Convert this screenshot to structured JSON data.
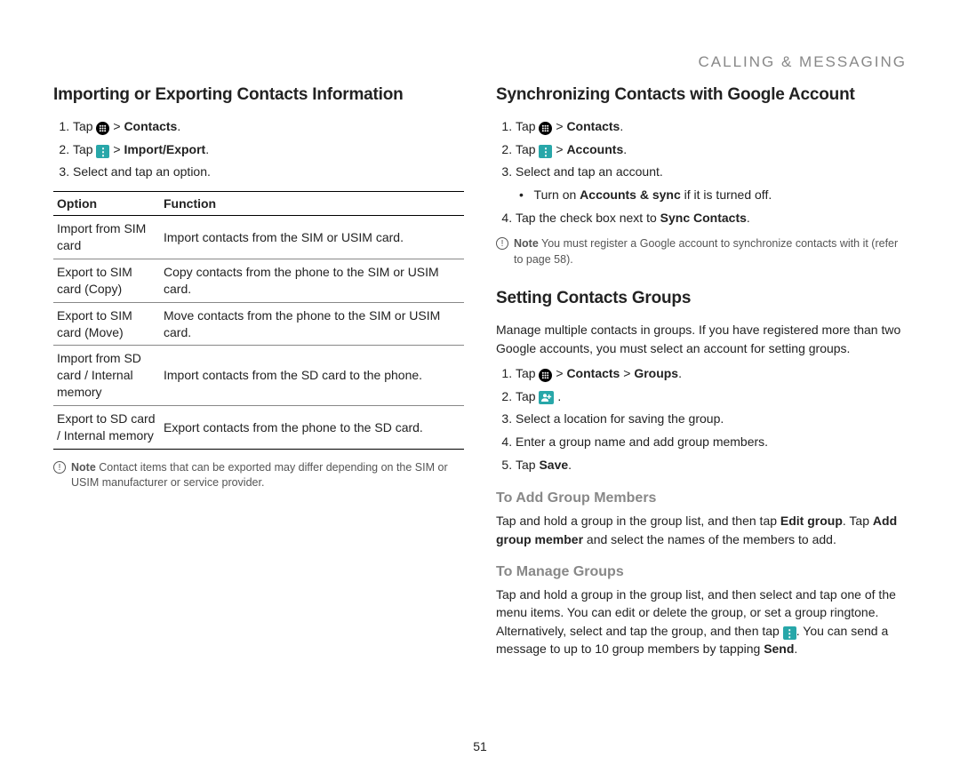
{
  "header": "CALLING & MESSAGING",
  "page_number": "51",
  "left": {
    "heading": "Importing or Exporting Contacts Information",
    "steps": {
      "s1_prefix": "Tap ",
      "s1_suffix": " > ",
      "s1_bold": "Contacts",
      "s1_end": ".",
      "s2_prefix": "Tap ",
      "s2_suffix": " > ",
      "s2_bold": "Import/Export",
      "s2_end": ".",
      "s3": "Select and tap an option."
    },
    "table": {
      "h1": "Option",
      "h2": "Function",
      "rows": [
        {
          "opt": "Import from SIM card",
          "fn": "Import contacts from the SIM or USIM card."
        },
        {
          "opt": "Export to SIM card (Copy)",
          "fn": "Copy contacts from the phone to the SIM or USIM card."
        },
        {
          "opt": "Export to SIM card (Move)",
          "fn": "Move contacts from the phone to the SIM or USIM card."
        },
        {
          "opt": "Import from SD card / Internal memory",
          "fn": "Import contacts from the SD card to the phone."
        },
        {
          "opt": "Export to SD card / Internal memory",
          "fn": "Export contacts from the phone to the SD card."
        }
      ]
    },
    "note": {
      "label": "Note",
      "text": " Contact items that can be exported may differ depending on the SIM or USIM manufacturer or service provider."
    }
  },
  "right": {
    "sync": {
      "heading": "Synchronizing Contacts with Google Account",
      "s1_prefix": "Tap ",
      "s1_suffix": " > ",
      "s1_bold": "Contacts",
      "s1_end": ".",
      "s2_prefix": "Tap ",
      "s2_suffix": " > ",
      "s2_bold": "Accounts",
      "s2_end": ".",
      "s3": "Select and tap an account.",
      "s3_sub_prefix": "Turn on ",
      "s3_sub_bold": "Accounts & sync",
      "s3_sub_suffix": " if it is turned off.",
      "s4_prefix": "Tap the check box next to ",
      "s4_bold": "Sync Contacts",
      "s4_end": ".",
      "note_label": "Note",
      "note_text": " You must register a Google account to synchronize contacts with it (refer to page 58)."
    },
    "groups": {
      "heading": "Setting Contacts Groups",
      "intro": "Manage multiple contacts in groups. If you have registered more than two Google accounts, you must select an account for setting groups.",
      "s1_prefix": "Tap ",
      "s1_suffix": " > ",
      "s1_bold1": "Contacts",
      "s1_mid": " > ",
      "s1_bold2": "Groups",
      "s1_end": ".",
      "s2_prefix": "Tap ",
      "s2_end": ".",
      "s3": "Select a location for saving the group.",
      "s4": "Enter a group name and add group members.",
      "s5_prefix": "Tap ",
      "s5_bold": "Save",
      "s5_end": "."
    },
    "add": {
      "heading": "To Add Group Members",
      "text_a": "Tap and hold a group in the group list, and then tap ",
      "text_bold1": "Edit group",
      "text_b": ". Tap ",
      "text_bold2": "Add group member",
      "text_c": " and select the names of the members to add."
    },
    "manage": {
      "heading": "To Manage Groups",
      "text_a": "Tap and hold a group in the group list, and then select and tap one of the menu items. You can edit or delete the group, or set a group ringtone. Alternatively, select and tap the group, and then tap ",
      "text_b": ". You can send a message to up to 10 group members by tapping ",
      "text_bold": "Send",
      "text_c": "."
    }
  }
}
